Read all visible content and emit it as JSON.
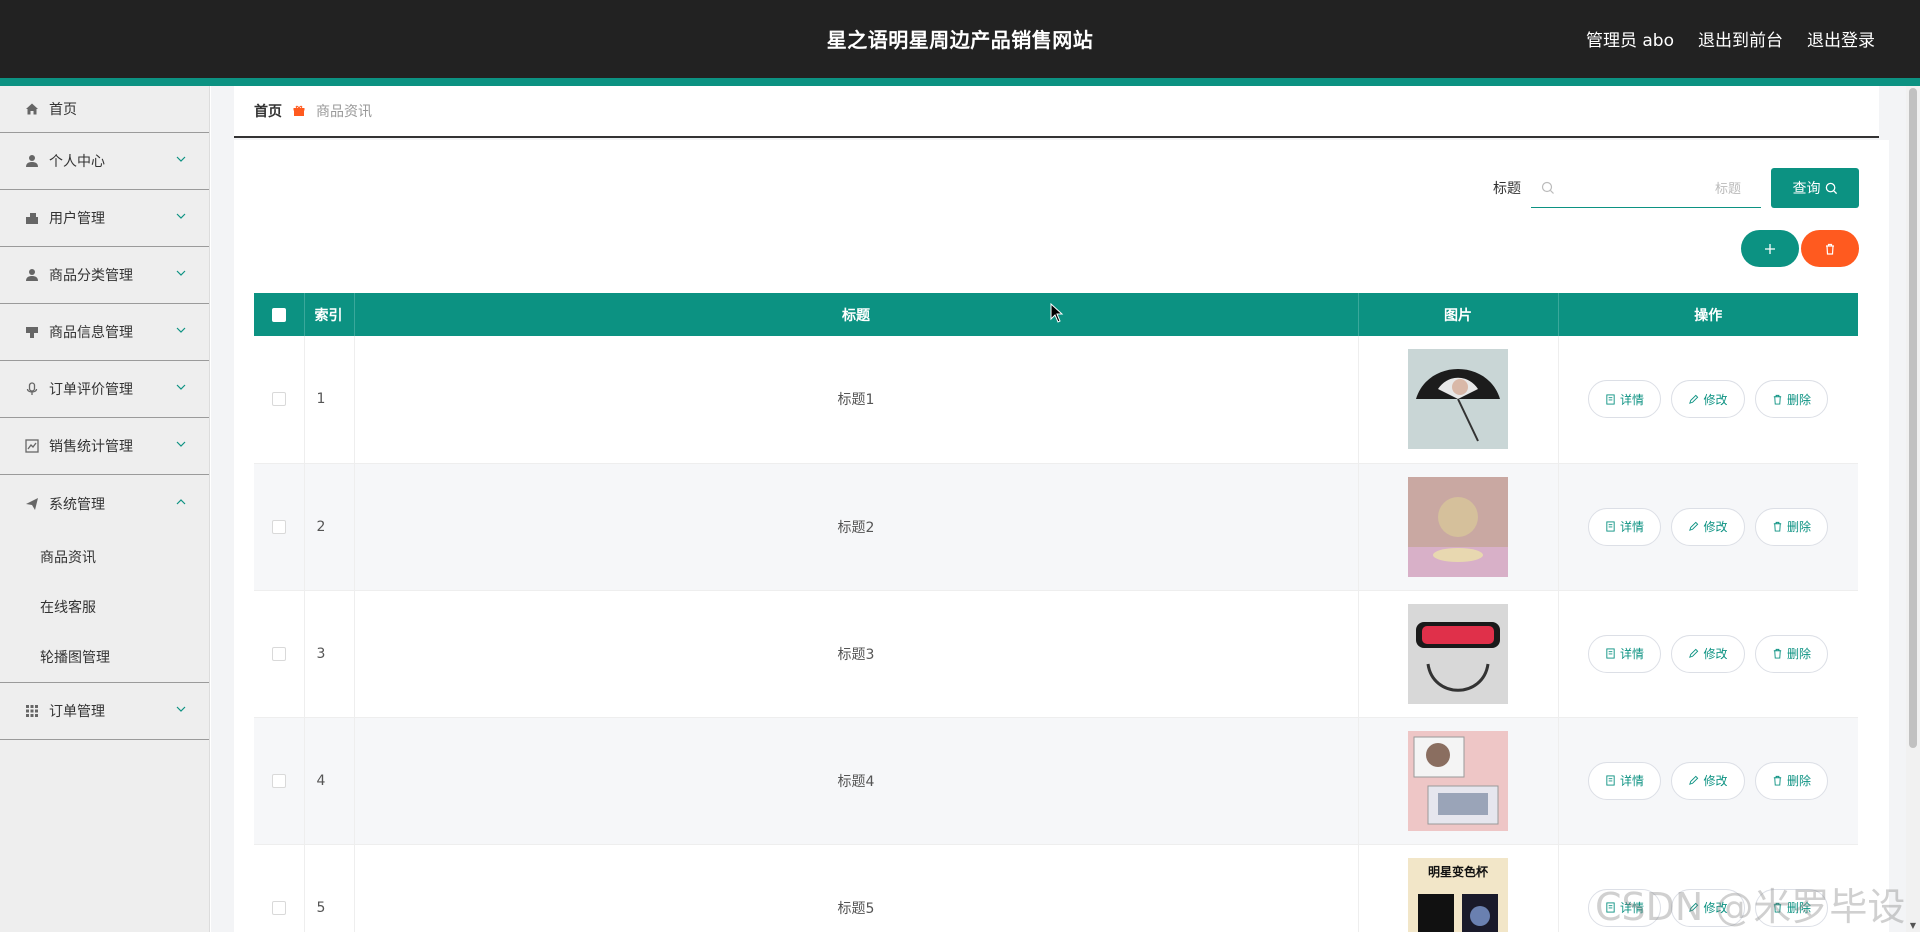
{
  "header": {
    "site_title": "星之语明星周边产品销售网站",
    "user_label": "管理员 abo",
    "to_front": "退出到前台",
    "logout": "退出登录"
  },
  "colors": {
    "accent": "#0c9282",
    "danger": "#ff5a1f",
    "header_bg": "#222222"
  },
  "sidebar": {
    "items": [
      {
        "label": "首页",
        "icon": "home-icon"
      },
      {
        "label": "个人中心",
        "icon": "user-icon"
      },
      {
        "label": "用户管理",
        "icon": "users-icon"
      },
      {
        "label": "商品分类管理",
        "icon": "user-icon"
      },
      {
        "label": "商品信息管理",
        "icon": "stamp-icon"
      },
      {
        "label": "订单评价管理",
        "icon": "microphone-icon"
      },
      {
        "label": "销售统计管理",
        "icon": "chart-icon"
      },
      {
        "label": "系统管理",
        "icon": "send-icon"
      },
      {
        "label": "订单管理",
        "icon": "grid-icon"
      }
    ],
    "system_sub": [
      "商品资讯",
      "在线客服",
      "轮播图管理"
    ]
  },
  "breadcrumb": {
    "home": "首页",
    "current": "商品资讯"
  },
  "search": {
    "label": "标题",
    "placeholder": "标题",
    "button": "查询"
  },
  "table": {
    "headers": {
      "index": "索引",
      "title": "标题",
      "image": "图片",
      "ops": "操作"
    },
    "rows": [
      {
        "index": "1",
        "title": "标题1"
      },
      {
        "index": "2",
        "title": "标题2"
      },
      {
        "index": "3",
        "title": "标题3"
      },
      {
        "index": "4",
        "title": "标题4"
      },
      {
        "index": "5",
        "title": "标题5"
      }
    ],
    "ops": {
      "detail": "详情",
      "edit": "修改",
      "delete": "删除"
    },
    "thumb5_text": "明星变色杯"
  },
  "watermark": "CSDN @米罗毕设"
}
